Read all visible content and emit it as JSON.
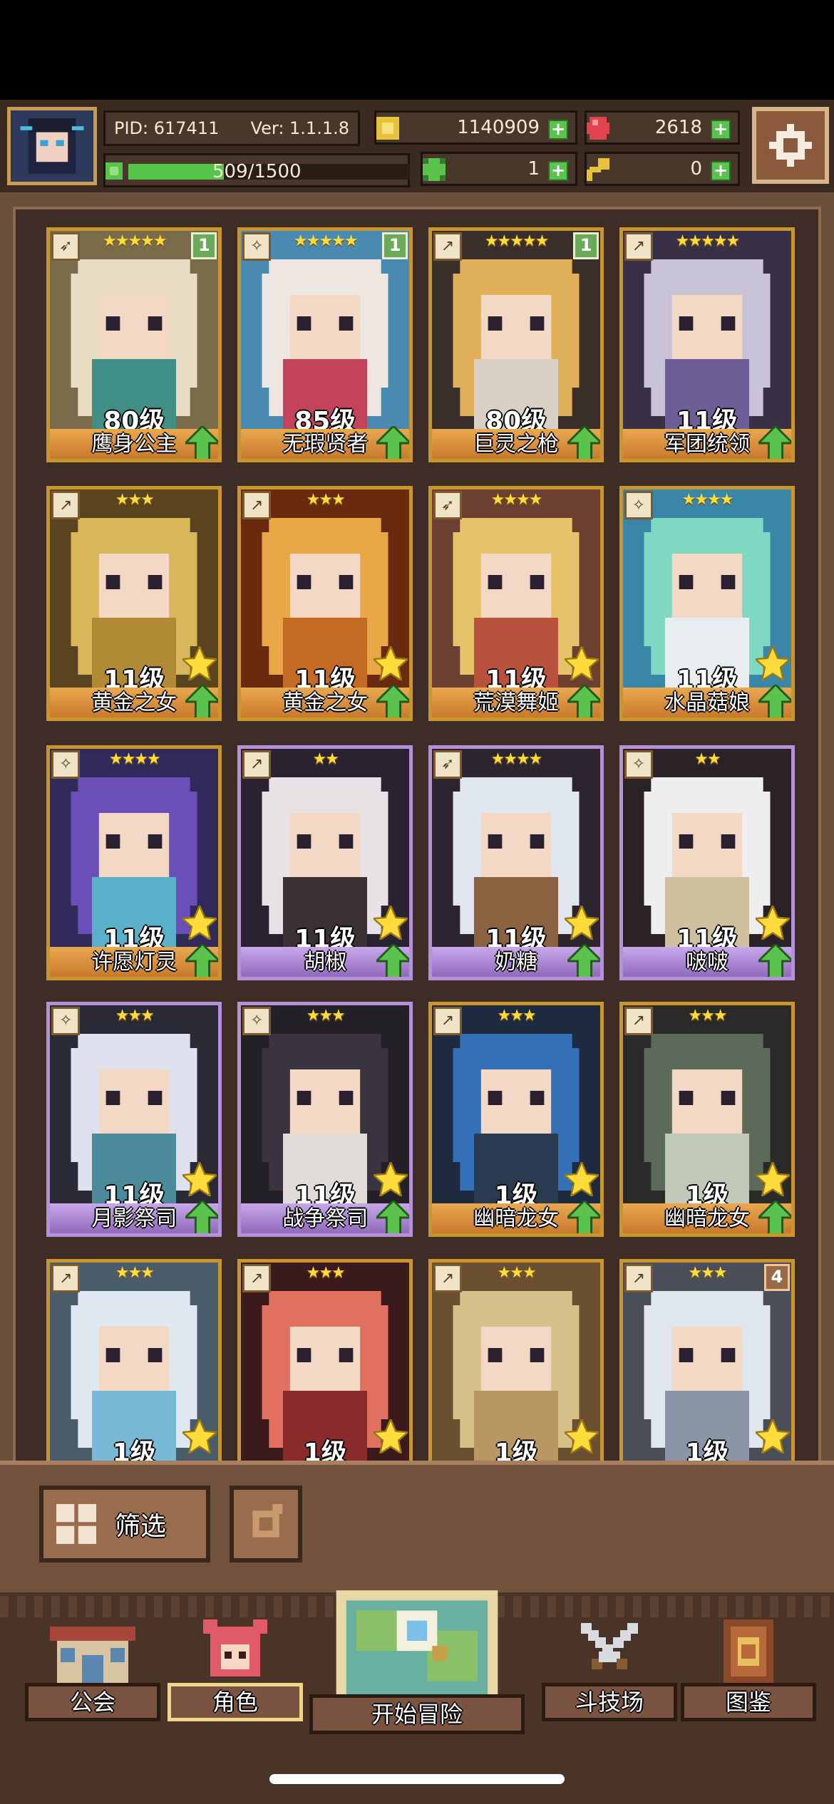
{
  "header": {
    "pid_label": "PID: 617411",
    "version_label": "Ver: 1.1.1.8",
    "exp": {
      "current": 509,
      "max": 1500,
      "text": "509/1500"
    },
    "resources": [
      {
        "name": "gold",
        "icon": "coin-icon",
        "value": "1140909",
        "color": "#e8c23b"
      },
      {
        "name": "gems",
        "icon": "ruby-icon",
        "value": "2618",
        "color": "#e0434d"
      },
      {
        "name": "clover",
        "icon": "clover-icon",
        "value": "1",
        "color": "#5bc24d"
      },
      {
        "name": "key",
        "icon": "key-icon",
        "value": "0",
        "color": "#e8c23b"
      }
    ]
  },
  "cards": [
    {
      "name": "鹰身公主",
      "level": "80级",
      "stars": "★★★★★",
      "frame": "gold",
      "badge": "1",
      "class_icon": "bow",
      "palette": [
        "#7a6b4a",
        "#e9dcc4",
        "#3f8f86"
      ]
    },
    {
      "name": "无瑕贤者",
      "level": "85级",
      "stars": "★★★★★",
      "frame": "gold",
      "badge": "1",
      "class_icon": "staff",
      "palette": [
        "#4a8ab0",
        "#eee7e1",
        "#c2435a"
      ]
    },
    {
      "name": "巨灵之枪",
      "level": "80级",
      "stars": "★★★★★",
      "frame": "gold",
      "badge": "1",
      "class_icon": "spear",
      "palette": [
        "#3a2e2a",
        "#e0b15a",
        "#d9d0c4"
      ]
    },
    {
      "name": "军团统领",
      "level": "11级",
      "stars": "★★★★★",
      "frame": "gold",
      "badge": "",
      "class_icon": "spear",
      "palette": [
        "#3a3046",
        "#c9c3d8",
        "#6e5e98"
      ]
    },
    {
      "name": "黄金之女",
      "level": "11级",
      "stars": "★★★",
      "frame": "gold",
      "badge": "",
      "class_icon": "spear",
      "palette": [
        "#5a4420",
        "#d8b65a",
        "#b08a35"
      ]
    },
    {
      "name": "黄金之女",
      "level": "11级",
      "stars": "★★★",
      "frame": "gold",
      "badge": "",
      "class_icon": "spear",
      "palette": [
        "#6a2a10",
        "#e9a646",
        "#c46a22"
      ]
    },
    {
      "name": "荒漠舞姬",
      "level": "11级",
      "stars": "★★★★",
      "frame": "gold",
      "badge": "",
      "class_icon": "bow",
      "palette": [
        "#6b4030",
        "#e6c36a",
        "#b8523c"
      ]
    },
    {
      "name": "水晶菇娘",
      "level": "11级",
      "stars": "★★★★",
      "frame": "gold",
      "badge": "",
      "class_icon": "staff",
      "palette": [
        "#3a86a8",
        "#7fd8c2",
        "#e8eef0"
      ]
    },
    {
      "name": "许愿灯灵",
      "level": "11级",
      "stars": "★★★★",
      "frame": "gold",
      "badge": "",
      "class_icon": "staff",
      "palette": [
        "#2f2a5a",
        "#6a4fb8",
        "#5ab0c8"
      ]
    },
    {
      "name": "胡椒",
      "level": "11级",
      "stars": "★★",
      "frame": "purple",
      "badge": "",
      "class_icon": "spear",
      "palette": [
        "#2a2230",
        "#e8e2e6",
        "#3a3036"
      ]
    },
    {
      "name": "奶糖",
      "level": "11级",
      "stars": "★★★★",
      "frame": "purple",
      "badge": "",
      "class_icon": "bow",
      "palette": [
        "#2c2530",
        "#dfe6ee",
        "#8a6240"
      ]
    },
    {
      "name": "啵啵",
      "level": "11级",
      "stars": "★★",
      "frame": "purple",
      "badge": "",
      "class_icon": "staff",
      "palette": [
        "#2a2226",
        "#eeeef0",
        "#cfc0a0"
      ]
    },
    {
      "name": "月影祭司",
      "level": "11级",
      "stars": "★★★",
      "frame": "purple",
      "badge": "",
      "class_icon": "staff",
      "palette": [
        "#2a2a36",
        "#dfe2ee",
        "#4a8a9a"
      ]
    },
    {
      "name": "战争祭司",
      "level": "11级",
      "stars": "★★★",
      "frame": "purple",
      "badge": "",
      "class_icon": "staff",
      "palette": [
        "#242028",
        "#3a3440",
        "#e0dcd8"
      ]
    },
    {
      "name": "幽暗龙女",
      "level": "1级",
      "stars": "★★★",
      "frame": "gold",
      "badge": "",
      "class_icon": "spear",
      "palette": [
        "#1e2a40",
        "#3470b8",
        "#2a3a50"
      ]
    },
    {
      "name": "幽暗龙女",
      "level": "1级",
      "stars": "★★★",
      "frame": "gold",
      "badge": "",
      "class_icon": "spear",
      "palette": [
        "#2a2a28",
        "#5c6a5a",
        "#c0c8b8"
      ]
    },
    {
      "name": "",
      "level": "1级",
      "stars": "★★★",
      "frame": "gold",
      "badge": "",
      "class_icon": "spear",
      "palette": [
        "#4a5c6a",
        "#dfe8f0",
        "#7ab8d8"
      ]
    },
    {
      "name": "",
      "level": "1级",
      "stars": "★★★",
      "frame": "gold",
      "badge": "",
      "class_icon": "spear",
      "palette": [
        "#3a1a1a",
        "#e07060",
        "#8a2a2a"
      ]
    },
    {
      "name": "",
      "level": "1级",
      "stars": "★★★",
      "frame": "gold",
      "badge": "",
      "class_icon": "spear",
      "palette": [
        "#6a5030",
        "#d8c08a",
        "#b89860"
      ]
    },
    {
      "name": "",
      "level": "1级",
      "stars": "★★★",
      "frame": "gold",
      "badge": "4",
      "class_icon": "spear",
      "palette": [
        "#4a4e58",
        "#e0e6ee",
        "#8a96a8"
      ]
    }
  ],
  "filter": {
    "label": "筛选"
  },
  "nav": {
    "guild": "公会",
    "character": "角色",
    "adventure": "开始冒险",
    "arena": "斗技场",
    "codex": "图鉴"
  }
}
